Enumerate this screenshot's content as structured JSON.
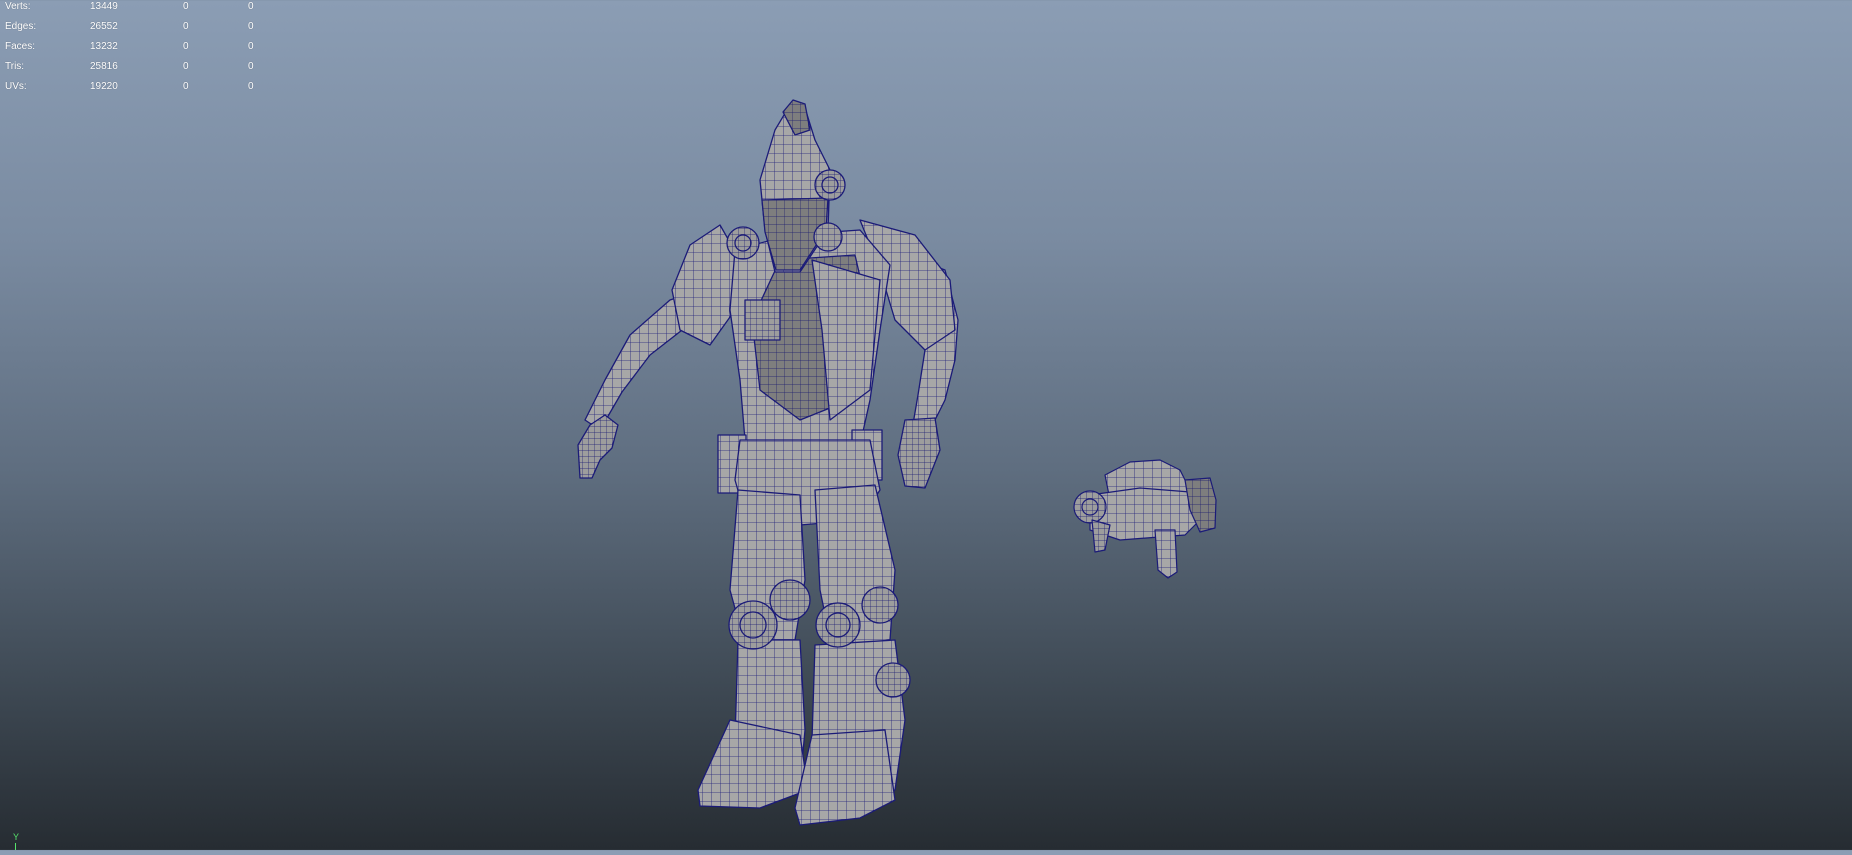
{
  "stats": [
    {
      "label": "Verts:",
      "values": [
        "13449",
        "0",
        "0"
      ]
    },
    {
      "label": "Edges:",
      "values": [
        "26552",
        "0",
        "0"
      ]
    },
    {
      "label": "Faces:",
      "values": [
        "13232",
        "0",
        "0"
      ]
    },
    {
      "label": "Tris:",
      "values": [
        "25816",
        "0",
        "0"
      ]
    },
    {
      "label": "UVs:",
      "values": [
        "19220",
        "0",
        "0"
      ]
    }
  ],
  "axis": {
    "label": "Y",
    "color": "#55e36b"
  },
  "colors": {
    "mesh_fill": "#a9a9a9",
    "mesh_shade": "#7c7c7c",
    "wire": "#1b1b78",
    "background_top": "#8b9db4",
    "background_bottom": "#262c32"
  },
  "models": [
    "robot-character-mesh",
    "blaster-gun-mesh"
  ]
}
